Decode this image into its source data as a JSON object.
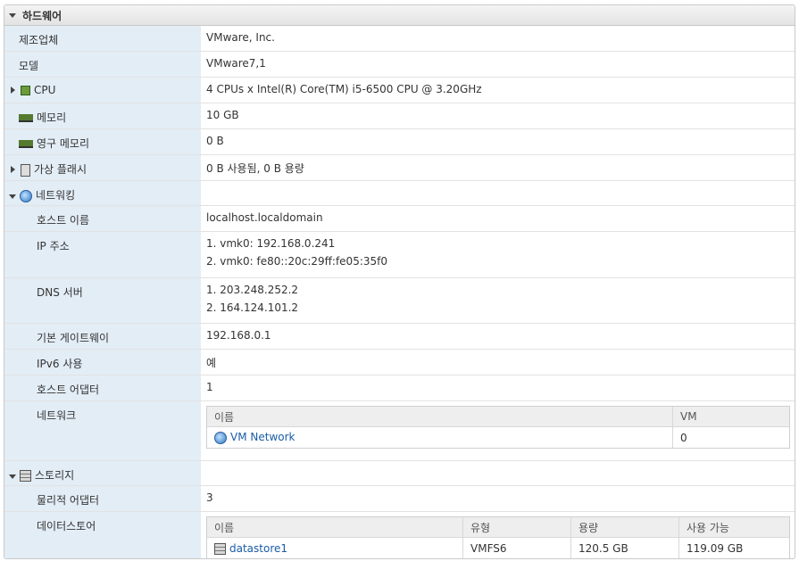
{
  "section": {
    "title": "하드웨어"
  },
  "rows": {
    "vendor": {
      "label": "제조업체",
      "value": "VMware, Inc."
    },
    "model": {
      "label": "모델",
      "value": "VMware7,1"
    },
    "cpu": {
      "label": "CPU",
      "value": "4 CPUs x Intel(R) Core(TM) i5-6500 CPU @ 3.20GHz"
    },
    "memory": {
      "label": "메모리",
      "value": "10 GB"
    },
    "persistent_memory": {
      "label": "영구 메모리",
      "value": "0 B"
    },
    "virtual_flash": {
      "label": "가상 플래시",
      "value": "0 B 사용됨, 0 B 용량"
    },
    "networking": {
      "label": "네트워킹",
      "value": ""
    },
    "hostname": {
      "label": "호스트 이름",
      "value": "localhost.localdomain"
    },
    "ip": {
      "label": "IP 주소",
      "values": [
        "1. vmk0: 192.168.0.241",
        "2. vmk0: fe80::20c:29ff:fe05:35f0"
      ]
    },
    "dns": {
      "label": "DNS 서버",
      "values": [
        "1. 203.248.252.2",
        "2. 164.124.101.2"
      ]
    },
    "gateway": {
      "label": "기본 게이트웨이",
      "value": "192.168.0.1"
    },
    "ipv6": {
      "label": "IPv6 사용",
      "value": "예"
    },
    "host_adapters": {
      "label": "호스트 어댑터",
      "value": "1"
    },
    "network": {
      "label": "네트워크",
      "headers": [
        "이름",
        "VM"
      ],
      "row": {
        "name": "VM Network",
        "vm": "0"
      }
    },
    "storage": {
      "label": "스토리지",
      "value": ""
    },
    "physical_adapters": {
      "label": "물리적 어댑터",
      "value": "3"
    },
    "datastore": {
      "label": "데이터스토어",
      "headers": [
        "이름",
        "유형",
        "용량",
        "사용 가능"
      ],
      "row": {
        "name": "datastore1",
        "type": "VMFS6",
        "capacity": "120.5 GB",
        "free": "119.09 GB"
      }
    }
  }
}
